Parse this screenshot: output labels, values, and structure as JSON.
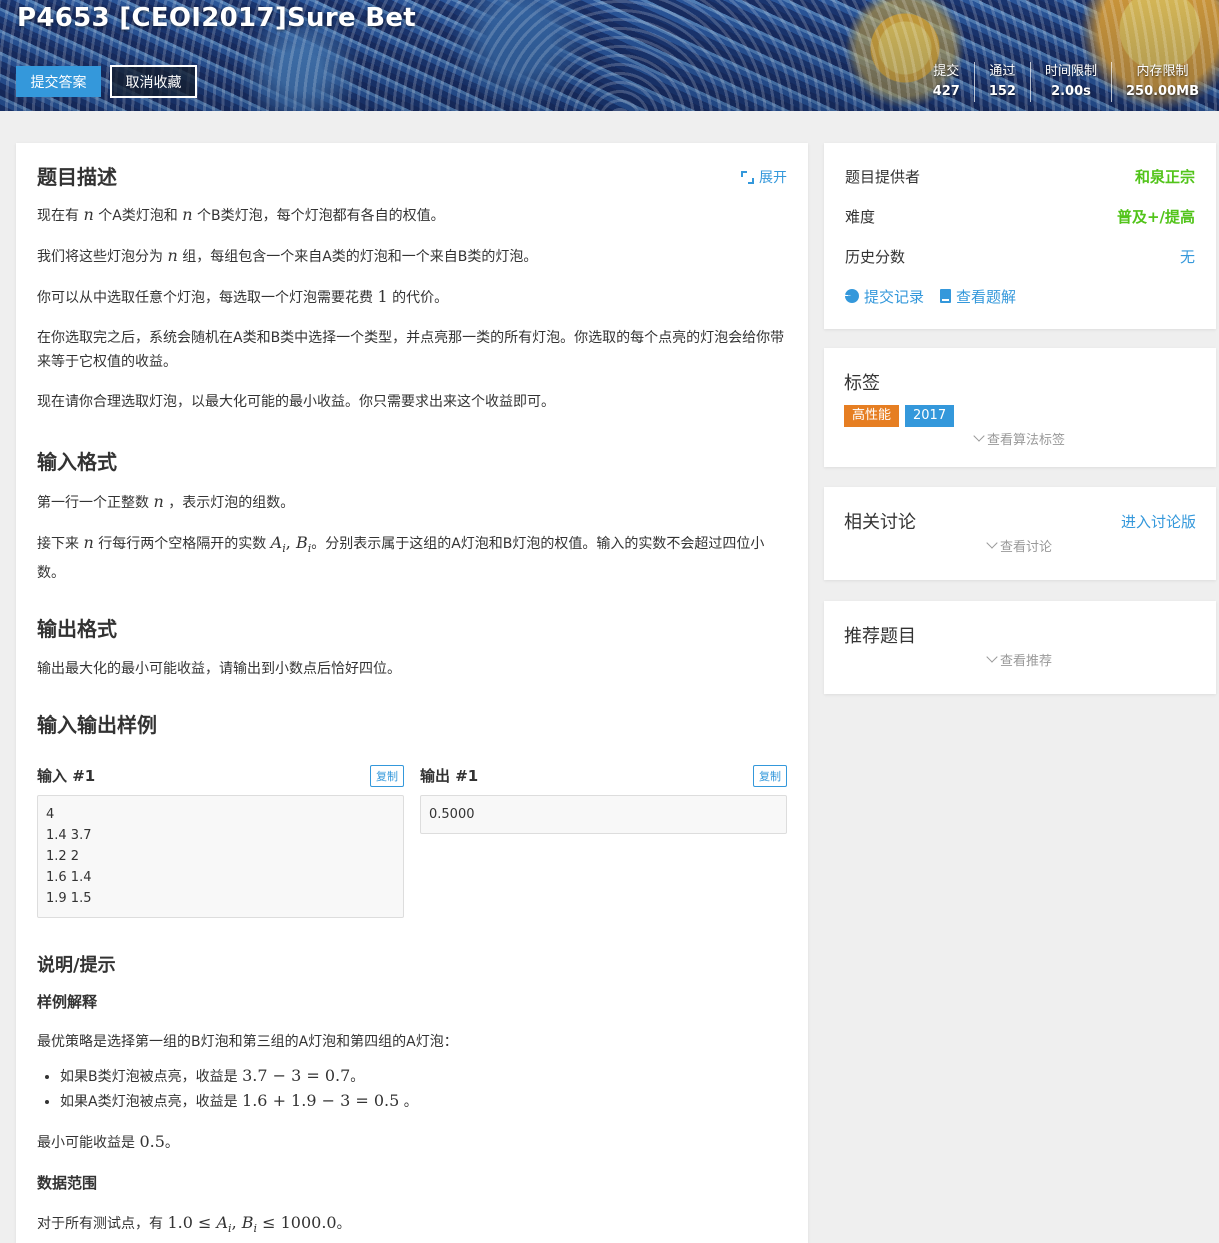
{
  "header": {
    "title": "P4653 [CEOI2017]Sure Bet",
    "submit_label": "提交答案",
    "unfavorite_label": "取消收藏",
    "stats": [
      {
        "label": "提交",
        "value": "427"
      },
      {
        "label": "通过",
        "value": "152"
      },
      {
        "label": "时间限制",
        "value": "2.00s"
      },
      {
        "label": "内存限制",
        "value": "250.00MB"
      }
    ]
  },
  "problem": {
    "desc_title": "题目描述",
    "expand_label": "展开",
    "desc": {
      "p1a": "现在有 ",
      "p1n1": "n",
      "p1b": " 个A类灯泡和 ",
      "p1n2": "n",
      "p1c": " 个B类灯泡，每个灯泡都有各自的权值。",
      "p2a": "我们将这些灯泡分为 ",
      "p2n": "n",
      "p2b": " 组，每组包含一个来自A类的灯泡和一个来自B类的灯泡。",
      "p3a": "你可以从中选取任意个灯泡，每选取一个灯泡需要花费 ",
      "p3n": "1",
      "p3b": " 的代价。",
      "p4": "在你选取完之后，系统会随机在A类和B类中选择一个类型，并点亮那一类的所有灯泡。你选取的每个点亮的灯泡会给你带来等于它权值的收益。",
      "p5": "现在请你合理选取灯泡，以最大化可能的最小收益。你只需要求出来这个收益即可。"
    },
    "input_title": "输入格式",
    "input": {
      "p1a": "第一行一个正整数 ",
      "p1n": "n",
      "p1b": " ，表示灯泡的组数。",
      "p2a": "接下来 ",
      "p2n": "n",
      "p2b": " 行每行两个空格隔开的实数 ",
      "p2m": "A",
      "p2sub1": "i",
      "p2comma": ", ",
      "p2m2": "B",
      "p2sub2": "i",
      "p2c": "。分别表示属于这组的A灯泡和B灯泡的权值。输入的实数不会超过四位小数。"
    },
    "output_title": "输出格式",
    "output": "输出最大化的最小可能收益，请输出到小数点后恰好四位。",
    "samples_title": "输入输出样例",
    "sample_in_label": "输入 #1",
    "sample_out_label": "输出 #1",
    "copy_label": "复制",
    "sample_in": "4\n1.4 3.7\n1.2 2\n1.6 1.4\n1.9 1.5",
    "sample_out": "0.5000",
    "hint_title": "说明/提示",
    "hint_sub1": "样例解释",
    "hint_p1": "最优策略是选择第一组的B灯泡和第三组的A灯泡和第四组的A灯泡：",
    "hint_li1a": "如果B类灯泡被点亮，收益是 ",
    "hint_li1m": "3.7 − 3 = 0.7",
    "hint_li1b": "。",
    "hint_li2a": "如果A类灯泡被点亮，收益是 ",
    "hint_li2m": "1.6 + 1.9 − 3 = 0.5",
    "hint_li2b": " 。",
    "hint_p2a": "最小可能收益是 ",
    "hint_p2m": "0.5",
    "hint_p2b": "。",
    "hint_sub2": "数据范围",
    "range_a": "对于所有测试点，有 ",
    "range_m1": "1.0 ≤ ",
    "range_A": "A",
    "range_i1": "i",
    "range_c": ", ",
    "range_B": "B",
    "range_i2": "i",
    "range_m2": " ≤ 1000.0",
    "range_b": "。"
  },
  "sidebar": {
    "info": {
      "provider_label": "题目提供者",
      "provider_value": "和泉正宗",
      "difficulty_label": "难度",
      "difficulty_value": "普及+/提高",
      "history_label": "历史分数",
      "history_value": "无",
      "records_label": "提交记录",
      "solutions_label": "查看题解"
    },
    "tags": {
      "title": "标签",
      "items": [
        {
          "label": "高性能",
          "color": "#e67e22"
        },
        {
          "label": "2017",
          "color": "#3498db"
        }
      ],
      "more_label": "查看算法标签"
    },
    "discuss": {
      "title": "相关讨论",
      "enter_label": "进入讨论版",
      "more_label": "查看讨论"
    },
    "recommend": {
      "title": "推荐题目",
      "more_label": "查看推荐"
    }
  }
}
